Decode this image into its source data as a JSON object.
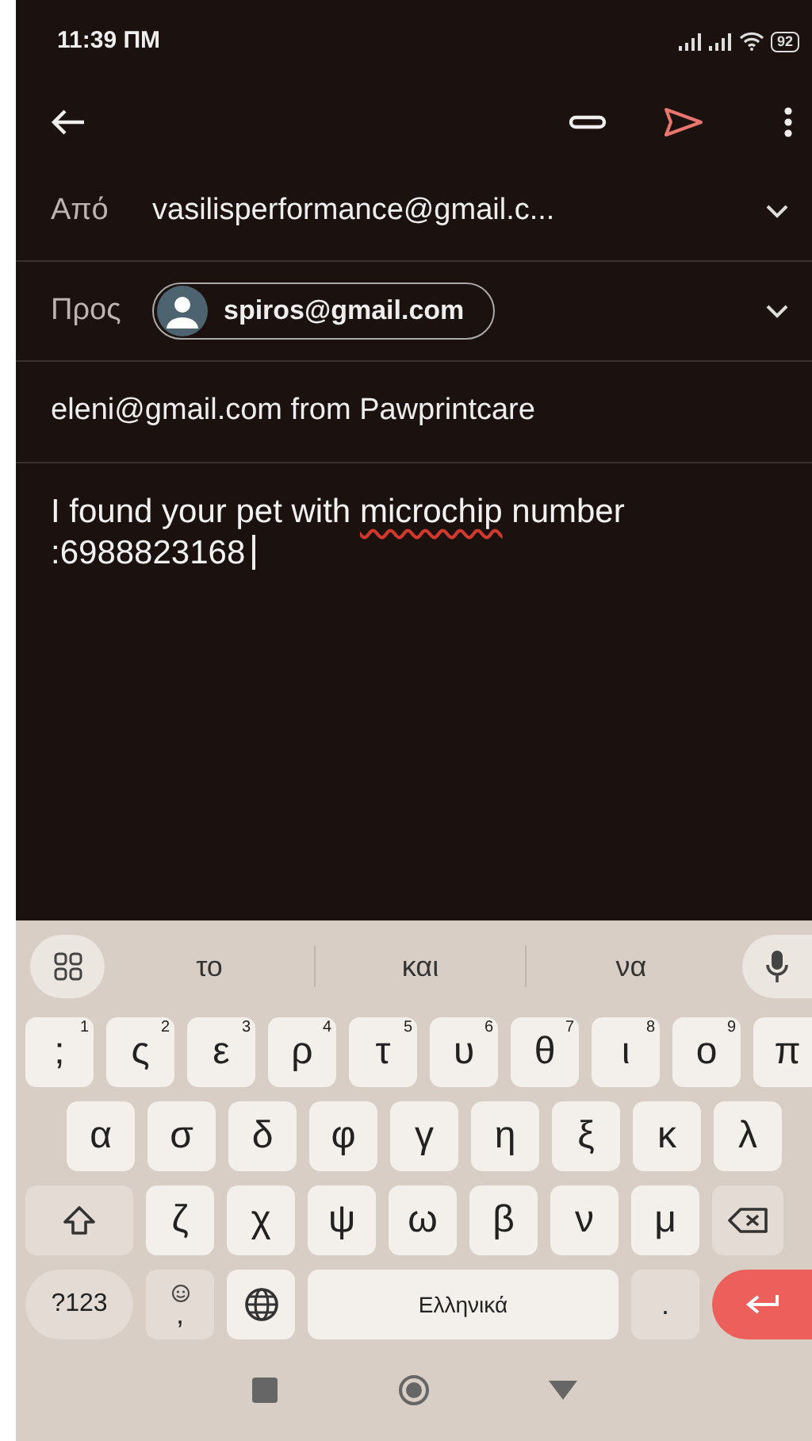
{
  "status_bar": {
    "time": "11:39 ΠΜ",
    "battery": "92"
  },
  "compose": {
    "from": {
      "label": "Από",
      "value": "vasilisperformance@gmail.c..."
    },
    "to": {
      "label": "Προς",
      "chips": [
        {
          "text": "spiros@gmail.com"
        }
      ]
    },
    "subject": "eleni@gmail.com from Pawprintcare",
    "body": [
      {
        "text": "I found your pet with ",
        "misspelled": false
      },
      {
        "text": "microchip",
        "misspelled": true
      },
      {
        "text": " number :6988823168",
        "misspelled": false
      }
    ]
  },
  "keyboard": {
    "suggestions": [
      "το",
      "και",
      "να"
    ],
    "key_rows": [
      {
        "keys": [
          {
            "kind": "letter",
            "label": ";",
            "hint": "1"
          },
          {
            "kind": "letter",
            "label": "ς",
            "hint": "2"
          },
          {
            "kind": "letter",
            "label": "ε",
            "hint": "3"
          },
          {
            "kind": "letter",
            "label": "ρ",
            "hint": "4"
          },
          {
            "kind": "letter",
            "label": "τ",
            "hint": "5"
          },
          {
            "kind": "letter",
            "label": "υ",
            "hint": "6"
          },
          {
            "kind": "letter",
            "label": "θ",
            "hint": "7"
          },
          {
            "kind": "letter",
            "label": "ι",
            "hint": "8"
          },
          {
            "kind": "letter",
            "label": "ο",
            "hint": "9"
          },
          {
            "kind": "letter",
            "label": "π"
          }
        ]
      },
      {
        "keys": [
          {
            "kind": "letter",
            "label": "α"
          },
          {
            "kind": "letter",
            "label": "σ"
          },
          {
            "kind": "letter",
            "label": "δ"
          },
          {
            "kind": "letter",
            "label": "φ"
          },
          {
            "kind": "letter",
            "label": "γ"
          },
          {
            "kind": "letter",
            "label": "η"
          },
          {
            "kind": "letter",
            "label": "ξ"
          },
          {
            "kind": "letter",
            "label": "κ"
          },
          {
            "kind": "letter",
            "label": "λ"
          }
        ]
      },
      {
        "keys": [
          {
            "kind": "shift"
          },
          {
            "kind": "letter",
            "label": "ζ"
          },
          {
            "kind": "letter",
            "label": "χ"
          },
          {
            "kind": "letter",
            "label": "ψ"
          },
          {
            "kind": "letter",
            "label": "ω"
          },
          {
            "kind": "letter",
            "label": "β"
          },
          {
            "kind": "letter",
            "label": "ν"
          },
          {
            "kind": "letter",
            "label": "μ"
          },
          {
            "kind": "backspace"
          }
        ]
      },
      {
        "keys": [
          {
            "kind": "mode",
            "label": "?123"
          },
          {
            "kind": "emoji",
            "label": ","
          },
          {
            "kind": "globe"
          },
          {
            "kind": "space",
            "label": "Ελληνικά"
          },
          {
            "kind": "period",
            "label": "."
          },
          {
            "kind": "enter"
          }
        ]
      }
    ]
  }
}
